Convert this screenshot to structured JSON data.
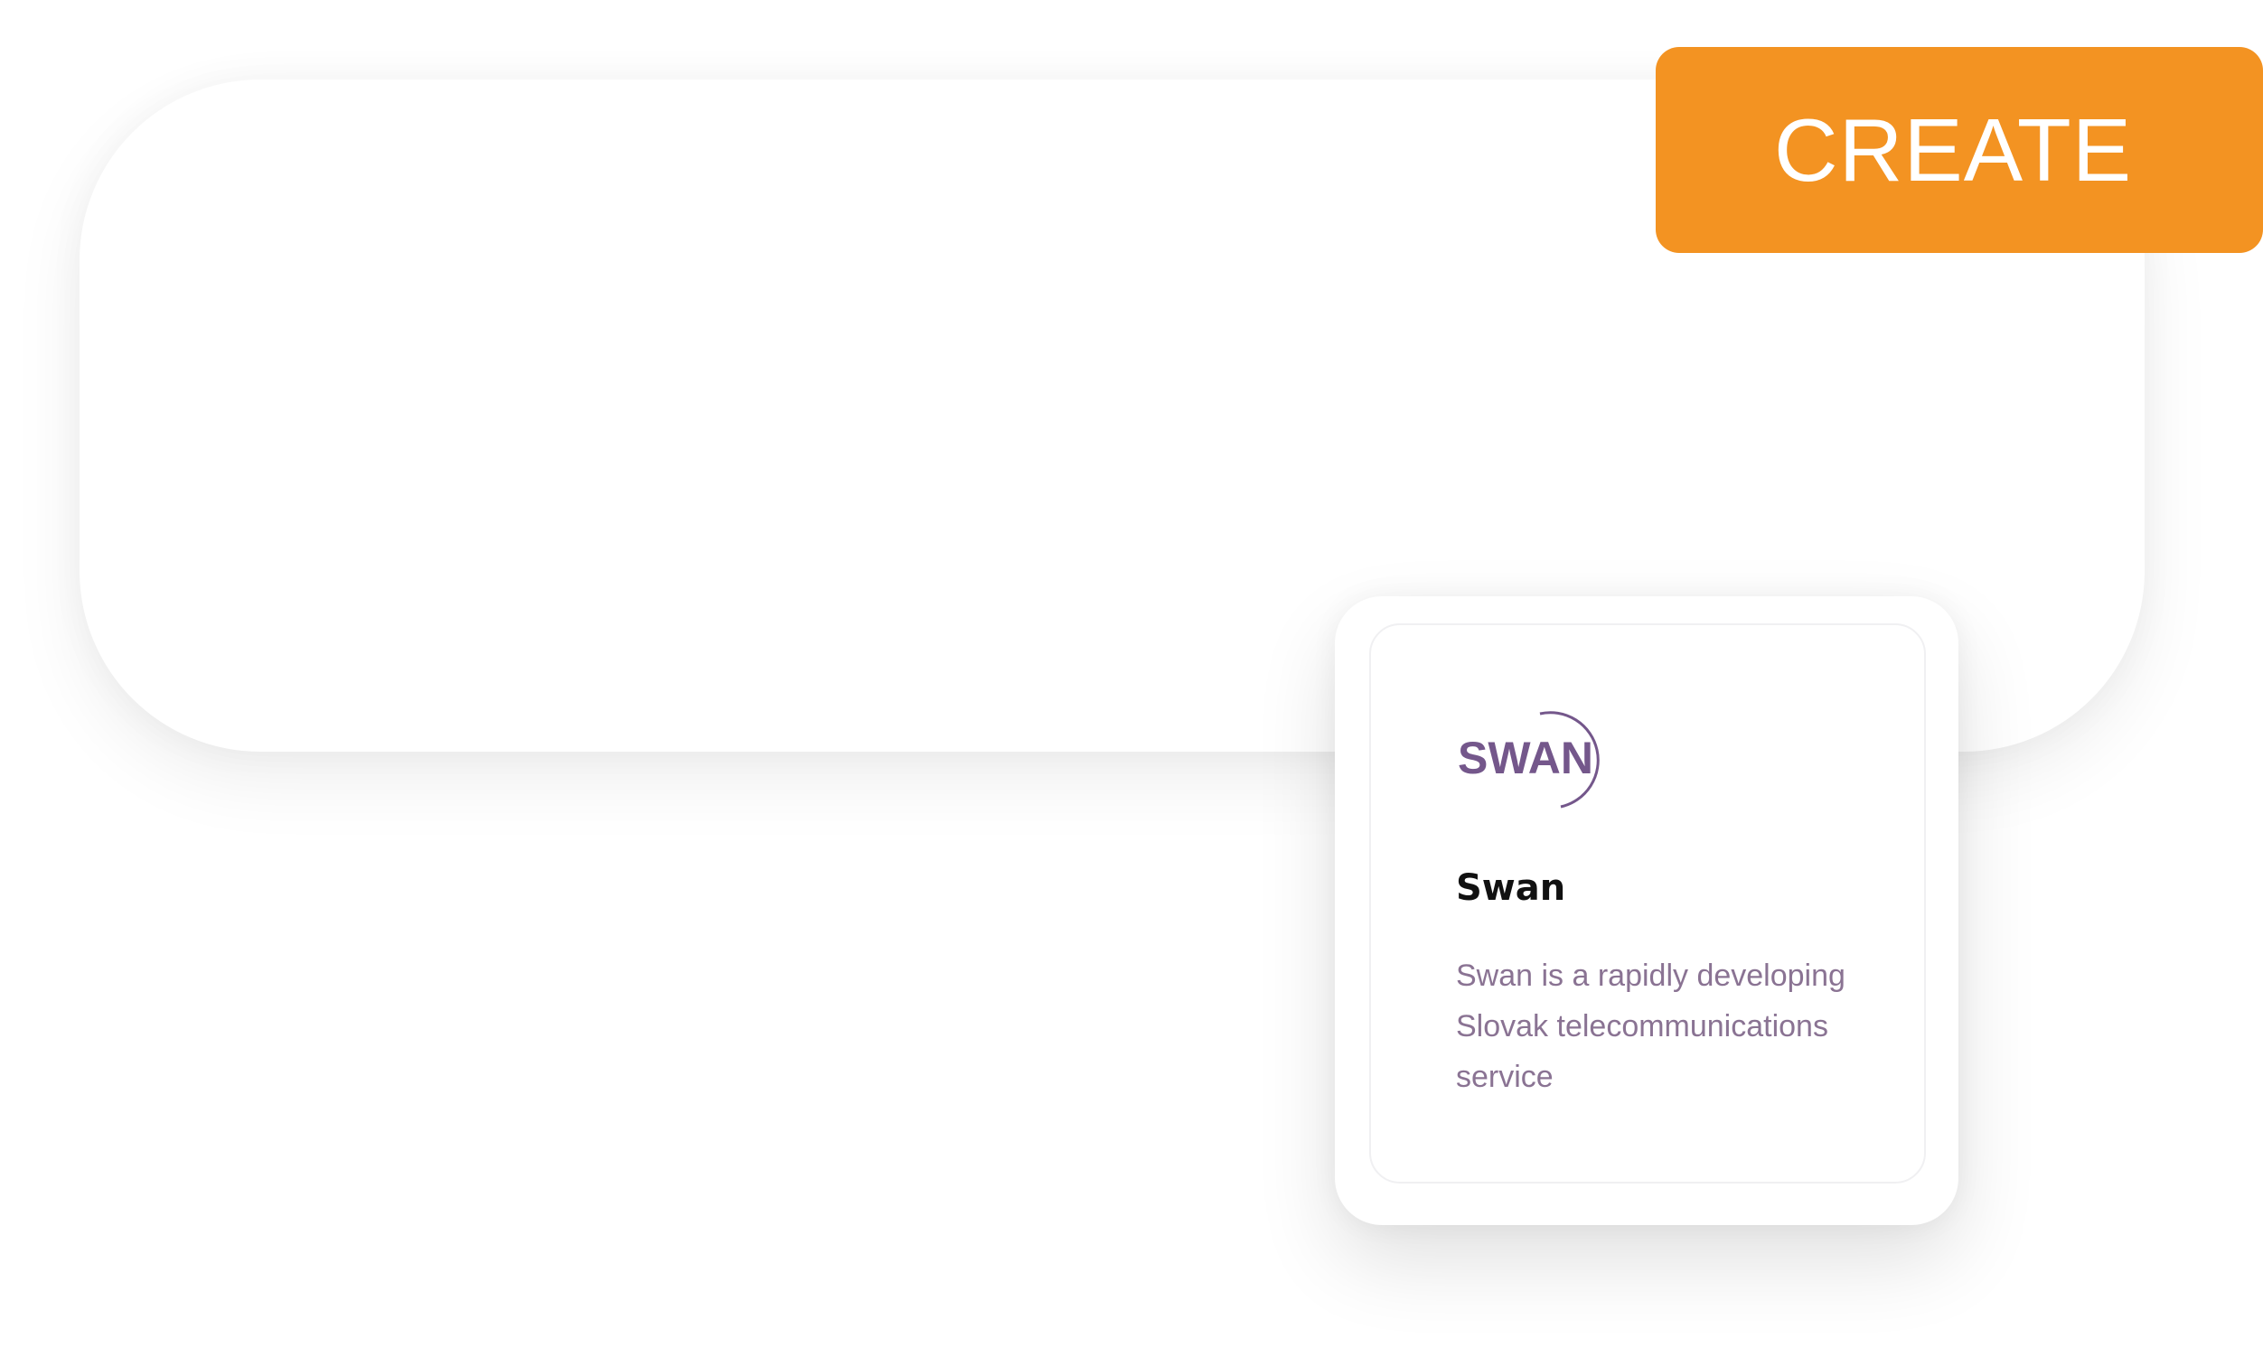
{
  "create_button": {
    "label": "CREATE",
    "color": "#f39322"
  },
  "card": {
    "logo_text": "SWAN",
    "logo_color": "#74578b",
    "title": "Swan",
    "description": "Swan is a rapidly developing Slovak telecommunications service"
  }
}
